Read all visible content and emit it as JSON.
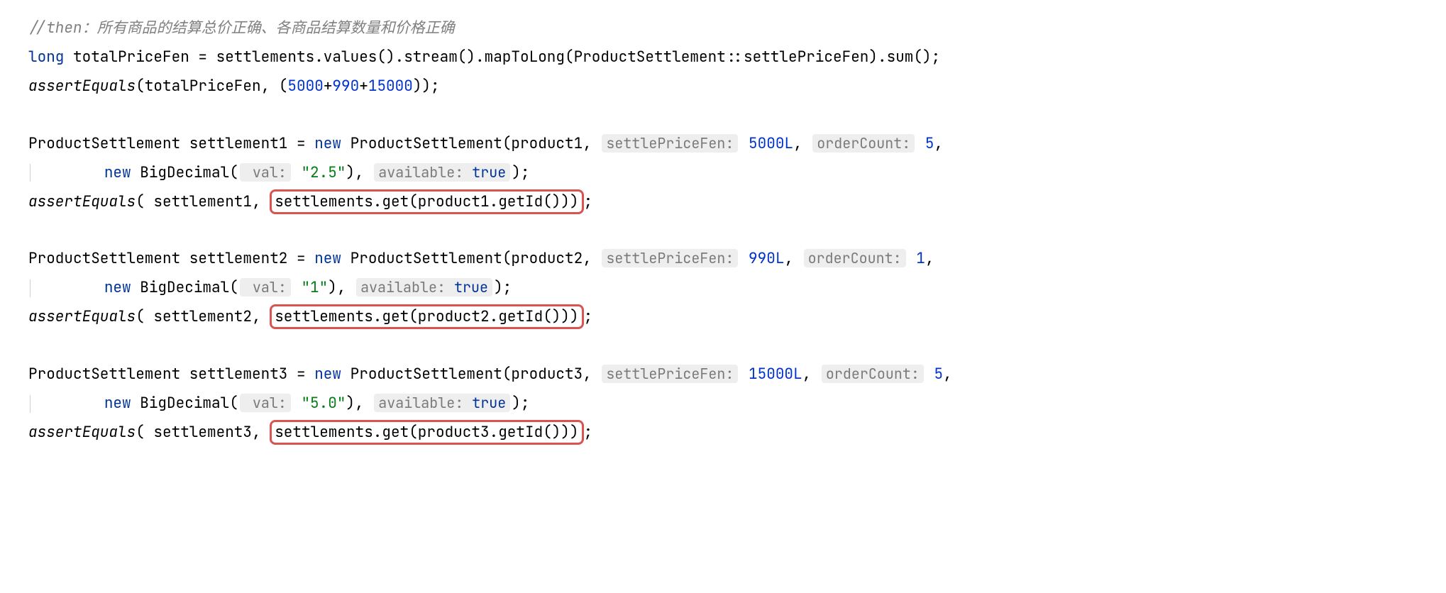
{
  "comment": "//then：所有商品的结算总价正确、各商品结算数量和价格正确",
  "line2": {
    "kw_long": "long",
    "var": " totalPriceFen = settlements.values().stream().mapToLong(ProductSettlement::settlePriceFen).sum();"
  },
  "line3": {
    "fn": "assertEquals",
    "open": "(totalPriceFen, (",
    "n1": "5000",
    "plus1": "+",
    "n2": "990",
    "plus2": "+",
    "n3": "15000",
    "close": "));"
  },
  "block1": {
    "decl_a": "ProductSettlement settlement1 = ",
    "kw_new": "new",
    "decl_b": " ProductSettlement(product1, ",
    "hint1": "settlePriceFen:",
    "num1": "5000L",
    "comma1": ", ",
    "hint2": "orderCount:",
    "num2": "5",
    "comma2": ",",
    "line2_kw_new": "new",
    "line2_a": " BigDecimal(",
    "line2_hint": " val:",
    "line2_str": "\"2.5\"",
    "line2_b": "), ",
    "line2_hint2": " available:",
    "line2_true": "true",
    "line2_c": ");",
    "assert_fn": "assertEquals",
    "assert_a": "( settlement1, ",
    "assert_boxed": "settlements.get(product1.getId()))",
    "assert_b": ";"
  },
  "block2": {
    "decl_a": "ProductSettlement settlement2 = ",
    "kw_new": "new",
    "decl_b": " ProductSettlement(product2, ",
    "hint1": "settlePriceFen:",
    "num1": "990L",
    "comma1": ", ",
    "hint2": "orderCount:",
    "num2": "1",
    "comma2": ",",
    "line2_kw_new": "new",
    "line2_a": " BigDecimal(",
    "line2_hint": " val:",
    "line2_str": "\"1\"",
    "line2_b": "), ",
    "line2_hint2": " available:",
    "line2_true": "true",
    "line2_c": ");",
    "assert_fn": "assertEquals",
    "assert_a": "( settlement2, ",
    "assert_boxed": "settlements.get(product2.getId()))",
    "assert_b": ";"
  },
  "block3": {
    "decl_a": "ProductSettlement settlement3 = ",
    "kw_new": "new",
    "decl_b": " ProductSettlement(product3, ",
    "hint1": "settlePriceFen:",
    "num1": "15000L",
    "comma1": ", ",
    "hint2": "orderCount:",
    "num2": "5",
    "comma2": ",",
    "line2_kw_new": "new",
    "line2_a": " BigDecimal(",
    "line2_hint": " val:",
    "line2_str": "\"5.0\"",
    "line2_b": "), ",
    "line2_hint2": " available:",
    "line2_true": "true",
    "line2_c": ");",
    "assert_fn": "assertEquals",
    "assert_a": "( settlement3, ",
    "assert_boxed": "settlements.get(product3.getId()))",
    "assert_b": ";"
  }
}
